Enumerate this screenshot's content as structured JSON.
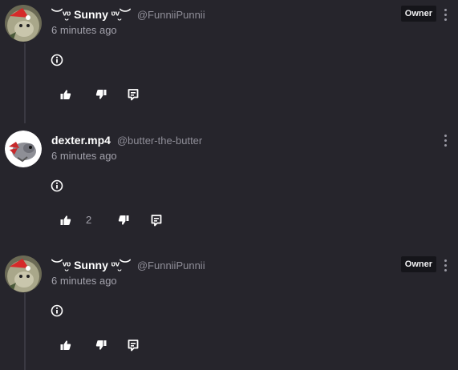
{
  "comments": [
    {
      "display_name": "︶ᵛ̮ᶹ Sunny ᶹᵛ̮︶",
      "handle": "@FunniiPunnii",
      "time": "6 minutes ago",
      "badge": "Owner",
      "like_count": ""
    },
    {
      "display_name": "dexter.mp4",
      "handle": "@butter-the-butter",
      "time": "6 minutes ago",
      "badge": "",
      "like_count": "2"
    },
    {
      "display_name": "︶ᵛ̮ᶹ Sunny ᶹᵛ̮︶",
      "handle": "@FunniiPunnii",
      "time": "6 minutes ago",
      "badge": "Owner",
      "like_count": ""
    }
  ],
  "icons": {
    "info": "info-circle-icon",
    "like": "thumbs-up-icon",
    "dislike": "thumbs-down-icon",
    "reply": "reply-icon",
    "more": "kebab-menu-icon"
  },
  "colors": {
    "background": "#26252c",
    "badge_bg": "#15151a",
    "thread_line": "#3a3942",
    "muted_text": "#a2a1ab"
  }
}
